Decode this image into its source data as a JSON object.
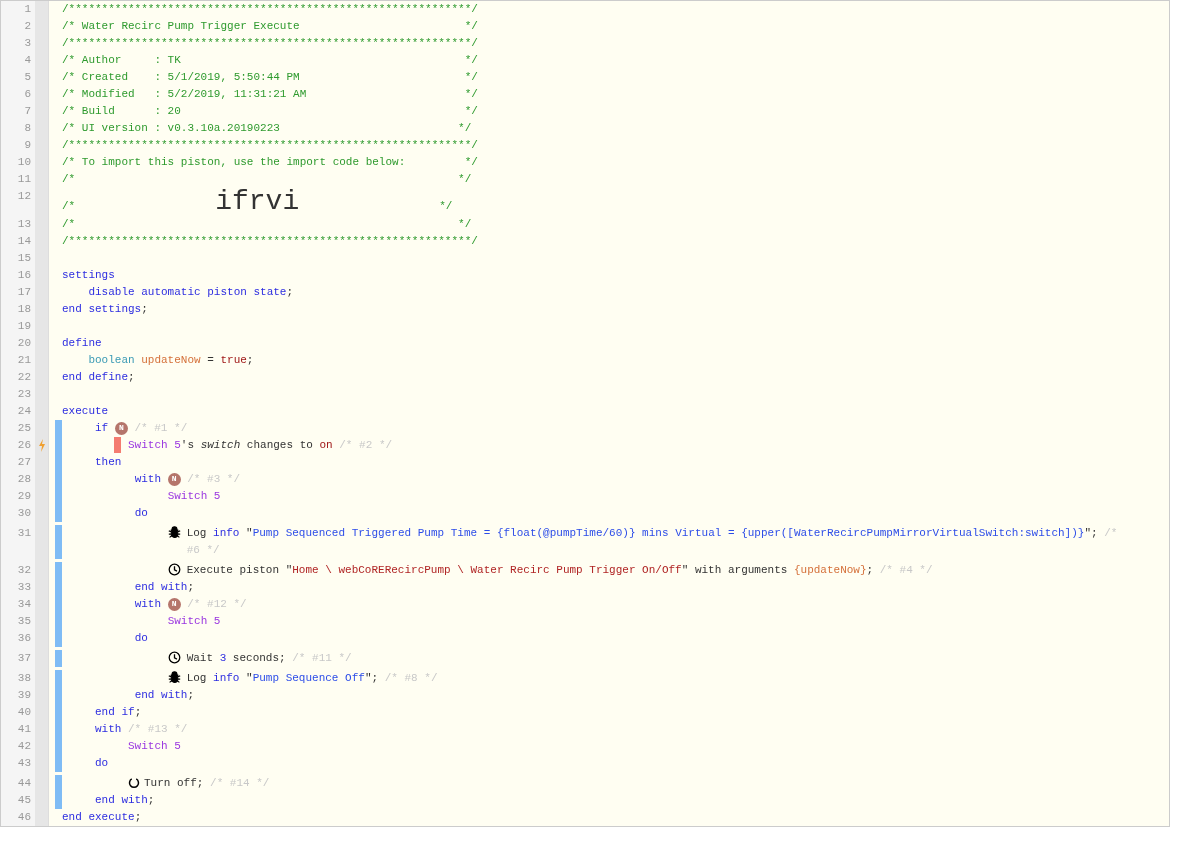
{
  "lines": [
    {
      "no": "1",
      "tokens": [
        {
          "kind": "comment",
          "text": "/*************************************************************/"
        }
      ]
    },
    {
      "no": "2",
      "tokens": [
        {
          "kind": "comment",
          "text": "/* Water Recirc Pump Trigger Execute                         */"
        }
      ]
    },
    {
      "no": "3",
      "tokens": [
        {
          "kind": "comment",
          "text": "/*************************************************************/"
        }
      ]
    },
    {
      "no": "4",
      "tokens": [
        {
          "kind": "comment",
          "text": "/* Author     : TK                                           */"
        }
      ]
    },
    {
      "no": "5",
      "tokens": [
        {
          "kind": "comment",
          "text": "/* Created    : 5/1/2019, 5:50:44 PM                         */"
        }
      ]
    },
    {
      "no": "6",
      "tokens": [
        {
          "kind": "comment",
          "text": "/* Modified   : 5/2/2019, 11:31:21 AM                        */"
        }
      ]
    },
    {
      "no": "7",
      "tokens": [
        {
          "kind": "comment",
          "text": "/* Build      : 20                                           */"
        }
      ]
    },
    {
      "no": "8",
      "tokens": [
        {
          "kind": "comment",
          "text": "/* UI version : v0.3.10a.20190223                           */"
        }
      ]
    },
    {
      "no": "9",
      "tokens": [
        {
          "kind": "comment",
          "text": "/*************************************************************/"
        }
      ]
    },
    {
      "no": "10",
      "tokens": [
        {
          "kind": "comment",
          "text": "/* To import this piston, use the import code below:         */"
        }
      ]
    },
    {
      "no": "11",
      "tokens": [
        {
          "kind": "comment",
          "text": "/*                                                          */"
        }
      ]
    },
    {
      "no": "12",
      "tokens": [
        {
          "kind": "comment",
          "text": "/*"
        },
        {
          "kind": "import_code",
          "text": "ifrvi"
        },
        {
          "kind": "comment",
          "text": "*/"
        }
      ]
    },
    {
      "no": "13",
      "tokens": [
        {
          "kind": "comment",
          "text": "/*                                                          */"
        }
      ]
    },
    {
      "no": "14",
      "tokens": [
        {
          "kind": "comment",
          "text": "/*************************************************************/"
        }
      ]
    },
    {
      "no": "15"
    },
    {
      "no": "16",
      "tokens": [
        {
          "kind": "keyword",
          "text": "settings"
        }
      ]
    },
    {
      "no": "17",
      "tokens": [
        {
          "kind": "keyword",
          "text": "    disable automatic piston state"
        },
        {
          "kind": "plain",
          "text": ";"
        }
      ]
    },
    {
      "no": "18",
      "tokens": [
        {
          "kind": "keyword",
          "text": "end settings"
        },
        {
          "kind": "plain",
          "text": ";"
        }
      ]
    },
    {
      "no": "19"
    },
    {
      "no": "20",
      "tokens": [
        {
          "kind": "keyword",
          "text": "define"
        }
      ]
    },
    {
      "no": "21",
      "tokens": [
        {
          "kind": "type",
          "text": "    boolean "
        },
        {
          "kind": "variable",
          "text": "updateNow"
        },
        {
          "kind": "plain",
          "text": " = "
        },
        {
          "kind": "literal",
          "text": "true"
        },
        {
          "kind": "plain",
          "text": ";"
        }
      ]
    },
    {
      "no": "22",
      "tokens": [
        {
          "kind": "keyword",
          "text": "end define"
        },
        {
          "kind": "plain",
          "text": ";"
        }
      ]
    },
    {
      "no": "23"
    },
    {
      "no": "24",
      "tokens": [
        {
          "kind": "keyword",
          "text": "execute"
        }
      ]
    },
    {
      "no": "25",
      "bar": true,
      "tokens": [
        {
          "kind": "keyword",
          "text": "     if "
        },
        {
          "kind": "badge",
          "text": "N"
        },
        {
          "kind": "note",
          "text": " /* #1 */"
        }
      ]
    },
    {
      "no": "26",
      "bar": true,
      "trigger": true,
      "tokens": [
        {
          "kind": "device",
          "text": "          Switch 5"
        },
        {
          "kind": "plain",
          "text": "'s "
        },
        {
          "kind": "italic",
          "text": "switch"
        },
        {
          "kind": "plain",
          "text": " changes to "
        },
        {
          "kind": "literal",
          "text": "on"
        },
        {
          "kind": "note",
          "text": " /* #2 */"
        }
      ]
    },
    {
      "no": "27",
      "bar": true,
      "tokens": [
        {
          "kind": "keyword",
          "text": "     then"
        }
      ]
    },
    {
      "no": "28",
      "bar": true,
      "tokens": [
        {
          "kind": "keyword",
          "text": "           with "
        },
        {
          "kind": "badge",
          "text": "N"
        },
        {
          "kind": "note",
          "text": " /* #3 */"
        }
      ]
    },
    {
      "no": "29",
      "bar": true,
      "tokens": [
        {
          "kind": "device",
          "text": "                Switch 5"
        }
      ]
    },
    {
      "no": "30",
      "bar": true,
      "tokens": [
        {
          "kind": "keyword",
          "text": "           do"
        }
      ]
    },
    {
      "no": "31",
      "bar": true,
      "kind": "log",
      "tokens": [
        {
          "kind": "plain",
          "text": "                Log "
        },
        {
          "kind": "keyword",
          "text": "info "
        },
        {
          "kind": "plain",
          "text": "\""
        },
        {
          "kind": "string",
          "text": "Pump Sequenced Triggered Pump Time = {float(@pumpTime/60)} mins Virtual = {upper([WaterRecircPumpMirrorVirtualSwitch:switch])}"
        },
        {
          "kind": "plain",
          "text": "\"; "
        },
        {
          "kind": "note",
          "text": "/* #6 */"
        }
      ]
    },
    {
      "no": "32",
      "bar": true,
      "kind": "timer",
      "tokens": [
        {
          "kind": "plain",
          "text": "                Execute piston \""
        },
        {
          "kind": "path",
          "text": "Home \\ webCoRERecircPump \\ Water Recirc Pump Trigger On/Off"
        },
        {
          "kind": "plain",
          "text": "\" with arguments "
        },
        {
          "kind": "variable",
          "text": "{updateNow}"
        },
        {
          "kind": "plain",
          "text": "; "
        },
        {
          "kind": "note",
          "text": "/* #4 */"
        }
      ]
    },
    {
      "no": "33",
      "bar": true,
      "tokens": [
        {
          "kind": "keyword",
          "text": "           end with"
        },
        {
          "kind": "plain",
          "text": ";"
        }
      ]
    },
    {
      "no": "34",
      "bar": true,
      "tokens": [
        {
          "kind": "keyword",
          "text": "           with "
        },
        {
          "kind": "badge",
          "text": "N"
        },
        {
          "kind": "note",
          "text": " /* #12 */"
        }
      ]
    },
    {
      "no": "35",
      "bar": true,
      "tokens": [
        {
          "kind": "device",
          "text": "                Switch 5"
        }
      ]
    },
    {
      "no": "36",
      "bar": true,
      "tokens": [
        {
          "kind": "keyword",
          "text": "           do"
        }
      ]
    },
    {
      "no": "37",
      "bar": true,
      "kind": "timer",
      "tokens": [
        {
          "kind": "plain",
          "text": "                Wait "
        },
        {
          "kind": "keyword",
          "text": "3"
        },
        {
          "kind": "plain",
          "text": " seconds; "
        },
        {
          "kind": "note",
          "text": "/* #11 */"
        }
      ]
    },
    {
      "no": "38",
      "bar": true,
      "kind": "log",
      "tokens": [
        {
          "kind": "plain",
          "text": "                Log "
        },
        {
          "kind": "keyword",
          "text": "info "
        },
        {
          "kind": "plain",
          "text": "\""
        },
        {
          "kind": "string",
          "text": "Pump Sequence Off"
        },
        {
          "kind": "plain",
          "text": "\"; "
        },
        {
          "kind": "note",
          "text": "/* #8 */"
        }
      ]
    },
    {
      "no": "39",
      "bar": true,
      "tokens": [
        {
          "kind": "keyword",
          "text": "           end with"
        },
        {
          "kind": "plain",
          "text": ";"
        }
      ]
    },
    {
      "no": "40",
      "bar": true,
      "tokens": [
        {
          "kind": "keyword",
          "text": "     end if"
        },
        {
          "kind": "plain",
          "text": ";"
        }
      ]
    },
    {
      "no": "41",
      "bar": true,
      "tokens": [
        {
          "kind": "keyword",
          "text": "     with"
        },
        {
          "kind": "note",
          "text": " /* #13 */"
        }
      ]
    },
    {
      "no": "42",
      "bar": true,
      "tokens": [
        {
          "kind": "device",
          "text": "          Switch 5"
        }
      ]
    },
    {
      "no": "43",
      "bar": true,
      "tokens": [
        {
          "kind": "keyword",
          "text": "     do"
        }
      ]
    },
    {
      "no": "44",
      "bar": true,
      "kind": "power",
      "tokens": [
        {
          "kind": "plain",
          "text": "          Turn off; "
        },
        {
          "kind": "note",
          "text": "/* #14 */"
        }
      ]
    },
    {
      "no": "45",
      "bar": true,
      "tokens": [
        {
          "kind": "keyword",
          "text": "     end with"
        },
        {
          "kind": "plain",
          "text": ";"
        }
      ]
    },
    {
      "no": "46",
      "tokens": [
        {
          "kind": "keyword",
          "text": "end execute"
        },
        {
          "kind": "plain",
          "text": ";"
        }
      ]
    }
  ]
}
